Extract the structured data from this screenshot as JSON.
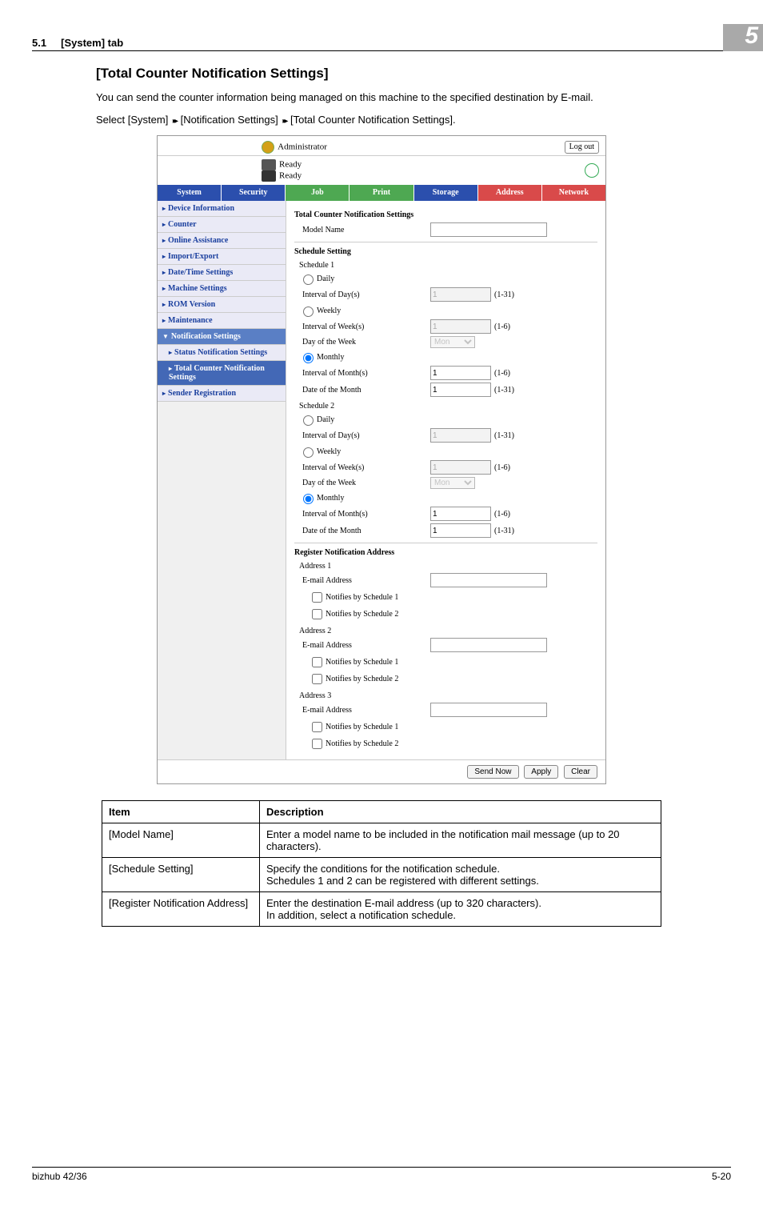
{
  "doc": {
    "section_ref": "5.1",
    "section_tab": "[System] tab",
    "chapter_badge": "5",
    "title": "[Total Counter Notification Settings]",
    "intro_line": "You can send the counter information being managed on this machine to the specified destination by E-mail.",
    "select_line_prefix": "Select [System] ",
    "select_line_mid1": " [Notification Settings] ",
    "select_line_suffix": " [Total Counter Notification Settings].",
    "footer_left": "bizhub 42/36",
    "footer_right": "5-20"
  },
  "ui": {
    "admin_label": "Administrator",
    "logout": "Log out",
    "ready1": "Ready",
    "ready2": "Ready",
    "tabs": {
      "system": "System",
      "security": "Security",
      "job": "Job",
      "print": "Print",
      "storage": "Storage",
      "address": "Address",
      "network": "Network"
    },
    "sidebar": {
      "device_info": "Device Information",
      "counter": "Counter",
      "online_assist": "Online Assistance",
      "import_export": "Import/Export",
      "date_time": "Date/Time Settings",
      "machine": "Machine Settings",
      "rom": "ROM Version",
      "maintenance": "Maintenance",
      "notification": "Notification Settings",
      "status_notif": "Status Notification Settings",
      "total_counter": "Total Counter Notification Settings",
      "sender_reg": "Sender Registration"
    },
    "main": {
      "heading": "Total Counter Notification Settings",
      "model_name_label": "Model Name",
      "model_name_value": "",
      "schedule_setting": "Schedule Setting",
      "schedule1": "Schedule 1",
      "schedule2": "Schedule 2",
      "daily": "Daily",
      "weekly": "Weekly",
      "monthly": "Monthly",
      "interval_day": "Interval of Day(s)",
      "interval_week": "Interval of Week(s)",
      "interval_month": "Interval of Month(s)",
      "day_of_week_label": "Day of the Week",
      "day_of_week_val": "Mon",
      "date_of_month": "Date of the Month",
      "range_1_31": "(1-31)",
      "range_1_6": "(1-6)",
      "val_1": "1",
      "reg_addr_heading": "Register Notification Address",
      "address1": "Address 1",
      "address2": "Address 2",
      "address3": "Address 3",
      "email_label": "E-mail Address",
      "notif_s1": "Notifies by Schedule 1",
      "notif_s2": "Notifies by Schedule 2",
      "btn_send": "Send Now",
      "btn_apply": "Apply",
      "btn_clear": "Clear"
    }
  },
  "table": {
    "col_item": "Item",
    "col_desc": "Description",
    "rows": [
      {
        "item": "[Model Name]",
        "desc": "Enter a model name to be included in the notification mail message (up to 20 characters)."
      },
      {
        "item": "[Schedule Setting]",
        "desc": "Specify the conditions for the notification schedule.\nSchedules 1 and 2 can be registered with different settings."
      },
      {
        "item": "[Register Notification Address]",
        "desc": "Enter the destination E-mail address (up to 320 characters).\nIn addition, select a notification schedule."
      }
    ]
  }
}
